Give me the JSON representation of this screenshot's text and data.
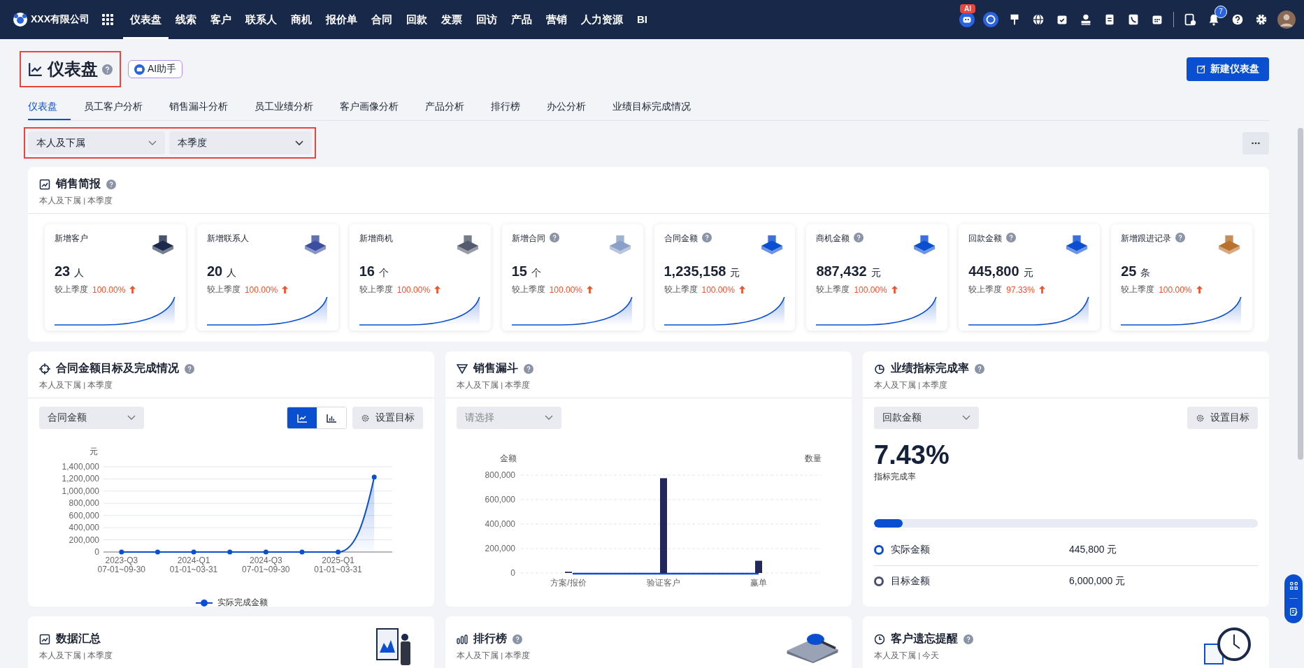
{
  "nav": {
    "company": "XXX有限公司",
    "menu": [
      {
        "label": "仪表盘",
        "selected": true
      },
      {
        "label": "线索",
        "selected": false
      },
      {
        "label": "客户",
        "selected": false
      },
      {
        "label": "联系人",
        "selected": false
      },
      {
        "label": "商机",
        "selected": false
      },
      {
        "label": "报价单",
        "selected": false
      },
      {
        "label": "合同",
        "selected": false
      },
      {
        "label": "回款",
        "selected": false
      },
      {
        "label": "发票",
        "selected": false
      },
      {
        "label": "回访",
        "selected": false
      },
      {
        "label": "产品",
        "selected": false
      },
      {
        "label": "营销",
        "selected": false
      },
      {
        "label": "人力资源",
        "selected": false
      },
      {
        "label": "BI",
        "selected": false
      }
    ],
    "ai_badge": "AI",
    "notification_count": "7"
  },
  "header": {
    "title": "仪表盘",
    "highlighted": true,
    "ai_button": "AI助手",
    "new_button": "新建仪表盘"
  },
  "tabs": [
    {
      "label": "仪表盘",
      "selected": true
    },
    {
      "label": "员工客户分析",
      "selected": false
    },
    {
      "label": "销售漏斗分析",
      "selected": false
    },
    {
      "label": "员工业绩分析",
      "selected": false
    },
    {
      "label": "客户画像分析",
      "selected": false
    },
    {
      "label": "产品分析",
      "selected": false
    },
    {
      "label": "排行榜",
      "selected": false
    },
    {
      "label": "办公分析",
      "selected": false
    },
    {
      "label": "业绩目标完成情况",
      "selected": false
    }
  ],
  "filters": {
    "highlighted": true,
    "scope": "本人及下属",
    "period": "本季度"
  },
  "brief": {
    "title": "销售简报",
    "subtitle": "本人及下属 | 本季度",
    "cards": [
      {
        "label": "新增客户",
        "help": false,
        "value": "23",
        "unit": "人",
        "compare": "较上季度",
        "change": "100.00%"
      },
      {
        "label": "新增联系人",
        "help": false,
        "value": "20",
        "unit": "人",
        "compare": "较上季度",
        "change": "100.00%"
      },
      {
        "label": "新增商机",
        "help": false,
        "value": "16",
        "unit": "个",
        "compare": "较上季度",
        "change": "100.00%"
      },
      {
        "label": "新增合同",
        "help": true,
        "value": "15",
        "unit": "个",
        "compare": "较上季度",
        "change": "100.00%"
      },
      {
        "label": "合同金额",
        "help": true,
        "value": "1,235,158",
        "unit": "元",
        "compare": "较上季度",
        "change": "100.00%"
      },
      {
        "label": "商机金额",
        "help": true,
        "value": "887,432",
        "unit": "元",
        "compare": "较上季度",
        "change": "100.00%"
      },
      {
        "label": "回款金额",
        "help": true,
        "value": "445,800",
        "unit": "元",
        "compare": "较上季度",
        "change": "97.33%"
      },
      {
        "label": "新增跟进记录",
        "help": true,
        "value": "25",
        "unit": "条",
        "compare": "较上季度",
        "change": "100.00%"
      }
    ]
  },
  "contract_target": {
    "title": "合同金额目标及完成情况",
    "subtitle": "本人及下属 | 本季度",
    "select": "合同金额",
    "view_toggle": [
      {
        "kind": "line",
        "selected": true
      },
      {
        "kind": "bar",
        "selected": false
      }
    ],
    "set_target": "设置目标",
    "chart_data": {
      "type": "line",
      "ylabel": "元",
      "grid": true,
      "categories": [
        "2023-Q3 07-01~09-30",
        null,
        "2024-Q1 01-01~03-31",
        null,
        "2024-Q3 07-01~09-30",
        null,
        "2025-Q1 01-01~03-31",
        null
      ],
      "ylim": [
        0,
        1400000
      ],
      "yticks": [
        {
          "value": 0,
          "label": "0"
        },
        {
          "value": 200000,
          "label": "200,000"
        },
        {
          "value": 400000,
          "label": "400,000"
        },
        {
          "value": 600000,
          "label": "600,000"
        },
        {
          "value": 800000,
          "label": "800,000"
        },
        {
          "value": 1000000,
          "label": "1,000,000"
        },
        {
          "value": 1200000,
          "label": "1,200,000"
        },
        {
          "value": 1400000,
          "label": "1,400,000"
        }
      ],
      "series": [
        {
          "name": "实际完成金额",
          "color": "#0a4fd0",
          "marker": "circle",
          "values": [
            0,
            0,
            0,
            0,
            0,
            0,
            0,
            1230000
          ]
        }
      ]
    }
  },
  "funnel": {
    "title": "销售漏斗",
    "subtitle": "本人及下属 | 本季度",
    "select_placeholder": "请选择",
    "y2label": "数量",
    "chart_data": {
      "type": "bar",
      "ylabel": "金额",
      "grid": true,
      "categories": [
        "方案/报价",
        "验证客户",
        "赢单"
      ],
      "ylim": [
        0,
        800000
      ],
      "yticks": [
        {
          "value": 0,
          "label": "0"
        },
        {
          "value": 200000,
          "label": "200,000"
        },
        {
          "value": 400000,
          "label": "400,000"
        },
        {
          "value": 600000,
          "label": "600,000"
        },
        {
          "value": 800000,
          "label": "800,000"
        }
      ],
      "series": [
        {
          "color": "#22295a",
          "values": [
            10000,
            775000,
            100000
          ]
        }
      ]
    }
  },
  "performance": {
    "title": "业绩指标完成率",
    "subtitle": "本人及下属 | 本季度",
    "select": "回款金额",
    "set_target": "设置目标",
    "rate": "7.43%",
    "rate_label": "指标完成率",
    "level": 0.0743,
    "legend": [
      {
        "label": "实际金额",
        "value": "445,800 元",
        "color": "#0a4fd0"
      },
      {
        "label": "目标金额",
        "value": "6,000,000 元",
        "color": "#4a4f6e"
      }
    ]
  },
  "bottom_cards": [
    {
      "title": "数据汇总",
      "help": false,
      "subtitle": "本人及下属 | 本季度"
    },
    {
      "title": "排行榜",
      "help": true,
      "subtitle": "本人及下属 | 本季度"
    },
    {
      "title": "客户遗忘提醒",
      "help": true,
      "subtitle": "本人及下属 | 今天"
    }
  ]
}
